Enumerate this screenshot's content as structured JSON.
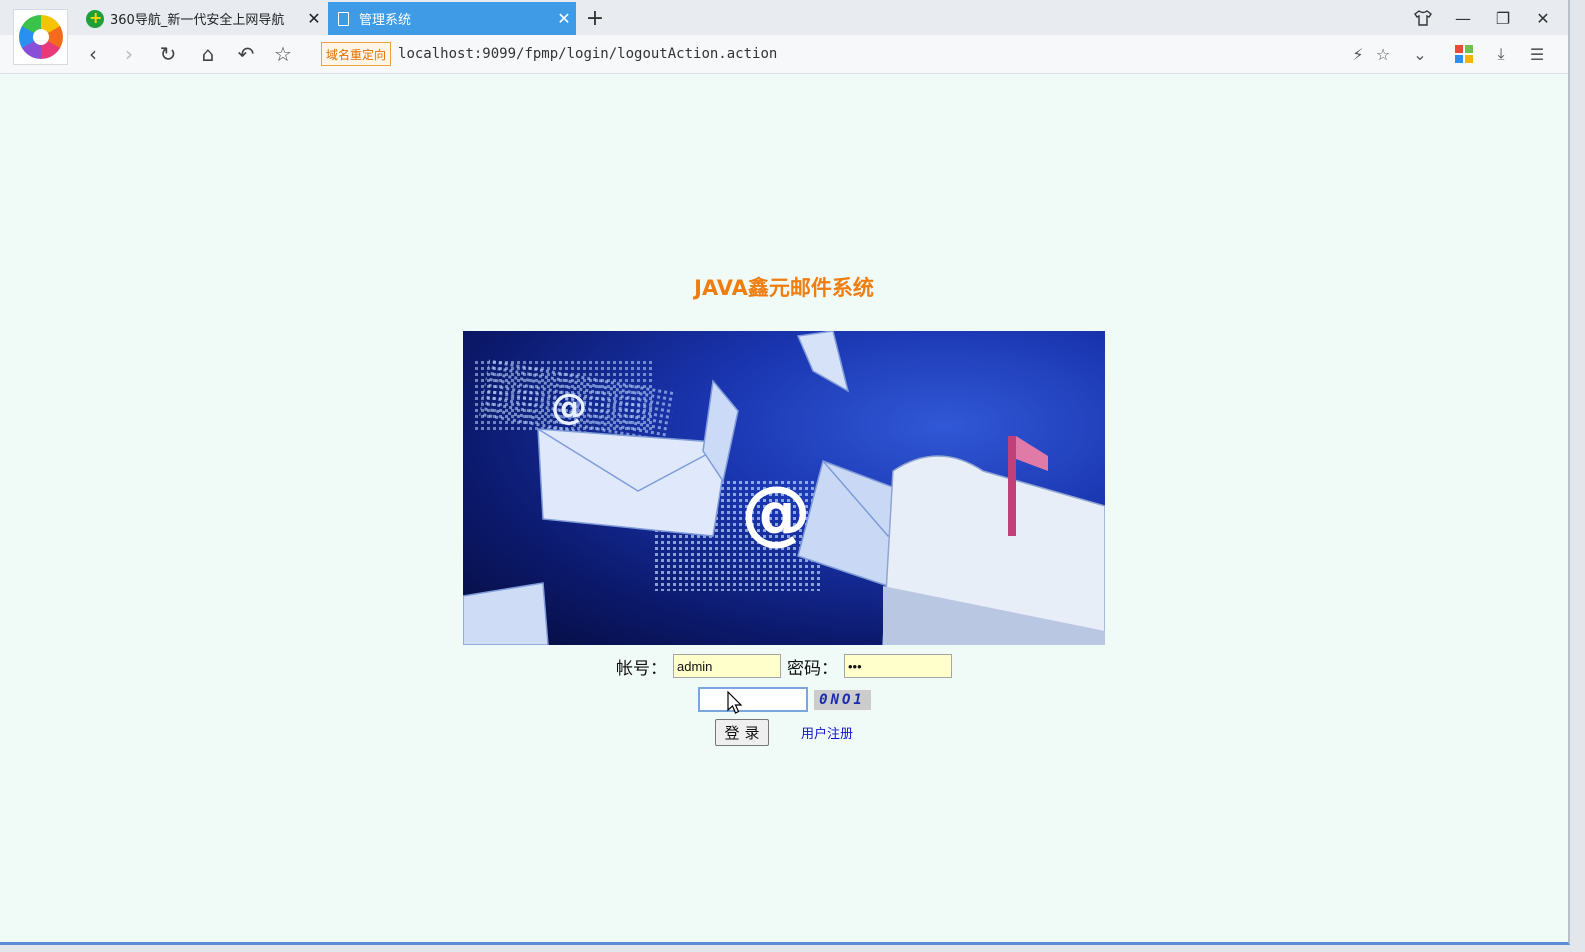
{
  "browser": {
    "tabs": [
      {
        "title": "360导航_新一代安全上网导航",
        "close": "✕"
      },
      {
        "title": "管理系统",
        "close": "✕"
      }
    ],
    "new_tab": "+",
    "window_controls": {
      "skin": "skin-icon",
      "minimize": "—",
      "restore": "❐",
      "close": "✕"
    },
    "nav": {
      "back": "‹",
      "forward": "›",
      "reload": "↻",
      "home": "⌂",
      "undo": "↶",
      "favorite": "☆"
    },
    "redirect_badge": "域名重定向",
    "url": "localhost:9099/fpmp/login/logoutAction.action",
    "url_icons": {
      "flash": "⚡",
      "star": "☆",
      "dropdown": "⌄",
      "download": "⤓",
      "menu": "☰"
    },
    "app_icon_colors": [
      "#e94b35",
      "#6cc24a",
      "#2a8ff0",
      "#f5b400"
    ]
  },
  "page": {
    "title": "JAVA鑫元邮件系统",
    "form": {
      "account_label": "帐号：",
      "account_value": "admin",
      "password_label": "密码：",
      "password_value": "•••",
      "captcha_value": "",
      "captcha_code": "0NO1",
      "login_button": "登录",
      "register_link": "用户注册"
    }
  },
  "colors": {
    "accent_tab": "#3f9be6",
    "title": "#f07d10",
    "page_bg": "#f0fbf7",
    "input_bg": "#ffffcc",
    "link": "#1313cc"
  }
}
